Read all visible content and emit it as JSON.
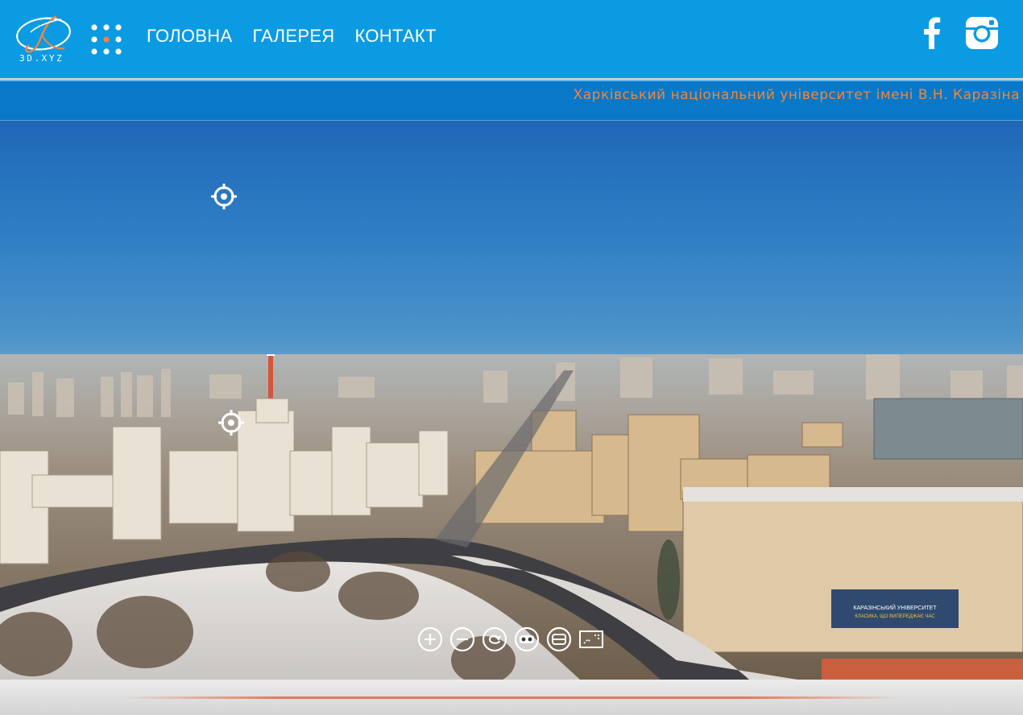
{
  "header": {
    "logo_text": "3D.XYZ",
    "nav": [
      {
        "label": "ГОЛОВНА"
      },
      {
        "label": "ГАЛЕРЕЯ"
      },
      {
        "label": "КОНТАКТ"
      }
    ],
    "social": [
      "facebook-icon",
      "instagram-icon"
    ]
  },
  "ticker": {
    "text": "Харківський національний університет імені В.Н. Каразіна"
  },
  "panorama": {
    "banner_line1": "КАРАЗІНСЬКИЙ УНІВЕРСИТЕТ",
    "banner_line2": "КЛАСИКА, ЩО ВИПЕРЕДЖАЄ ЧАС",
    "hotspots": [
      "hotspot-icon",
      "hotspot-icon"
    ],
    "controls": [
      "zoom-in-icon",
      "zoom-out-icon",
      "rotate-icon",
      "vr-icon",
      "view-mode-icon",
      "fullscreen-icon"
    ]
  },
  "colors": {
    "header_bg": "#0b9be3",
    "ticker_bg": "#0879c8",
    "ticker_text": "#f0863c",
    "accent": "#e8795a"
  }
}
